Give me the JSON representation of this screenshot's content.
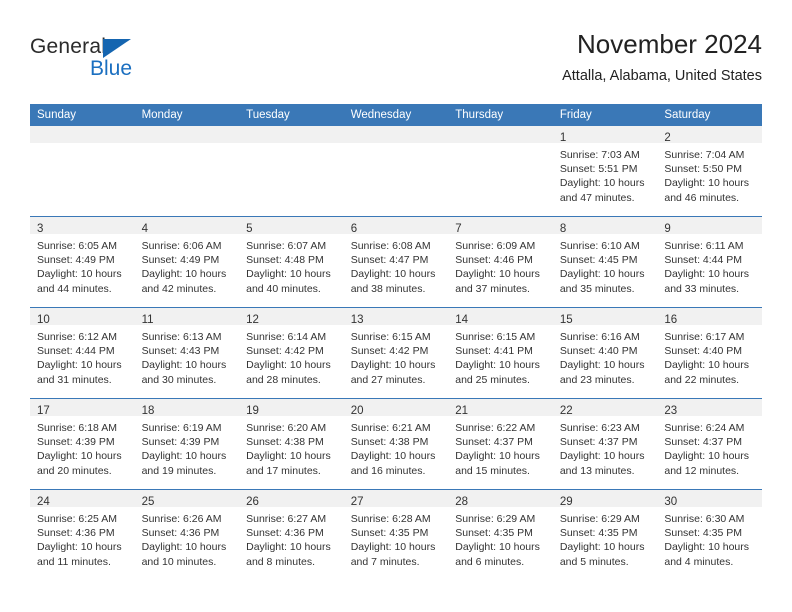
{
  "brand": {
    "name_top": "General",
    "name_bottom": "Blue",
    "triangle_color": "#1565b0",
    "blue_color": "#1b6fc0"
  },
  "header": {
    "title": "November 2024",
    "subtitle": "Attalla, Alabama, United States"
  },
  "theme": {
    "header_blue": "#3a78b7",
    "daynum_band": "#f1f1f1",
    "text": "#333333"
  },
  "columns": [
    "Sunday",
    "Monday",
    "Tuesday",
    "Wednesday",
    "Thursday",
    "Friday",
    "Saturday"
  ],
  "weeks": [
    [
      {
        "day": "",
        "sunrise": "",
        "sunset": "",
        "daylight": ""
      },
      {
        "day": "",
        "sunrise": "",
        "sunset": "",
        "daylight": ""
      },
      {
        "day": "",
        "sunrise": "",
        "sunset": "",
        "daylight": ""
      },
      {
        "day": "",
        "sunrise": "",
        "sunset": "",
        "daylight": ""
      },
      {
        "day": "",
        "sunrise": "",
        "sunset": "",
        "daylight": ""
      },
      {
        "day": "1",
        "sunrise": "Sunrise: 7:03 AM",
        "sunset": "Sunset: 5:51 PM",
        "daylight": "Daylight: 10 hours and 47 minutes."
      },
      {
        "day": "2",
        "sunrise": "Sunrise: 7:04 AM",
        "sunset": "Sunset: 5:50 PM",
        "daylight": "Daylight: 10 hours and 46 minutes."
      }
    ],
    [
      {
        "day": "3",
        "sunrise": "Sunrise: 6:05 AM",
        "sunset": "Sunset: 4:49 PM",
        "daylight": "Daylight: 10 hours and 44 minutes."
      },
      {
        "day": "4",
        "sunrise": "Sunrise: 6:06 AM",
        "sunset": "Sunset: 4:49 PM",
        "daylight": "Daylight: 10 hours and 42 minutes."
      },
      {
        "day": "5",
        "sunrise": "Sunrise: 6:07 AM",
        "sunset": "Sunset: 4:48 PM",
        "daylight": "Daylight: 10 hours and 40 minutes."
      },
      {
        "day": "6",
        "sunrise": "Sunrise: 6:08 AM",
        "sunset": "Sunset: 4:47 PM",
        "daylight": "Daylight: 10 hours and 38 minutes."
      },
      {
        "day": "7",
        "sunrise": "Sunrise: 6:09 AM",
        "sunset": "Sunset: 4:46 PM",
        "daylight": "Daylight: 10 hours and 37 minutes."
      },
      {
        "day": "8",
        "sunrise": "Sunrise: 6:10 AM",
        "sunset": "Sunset: 4:45 PM",
        "daylight": "Daylight: 10 hours and 35 minutes."
      },
      {
        "day": "9",
        "sunrise": "Sunrise: 6:11 AM",
        "sunset": "Sunset: 4:44 PM",
        "daylight": "Daylight: 10 hours and 33 minutes."
      }
    ],
    [
      {
        "day": "10",
        "sunrise": "Sunrise: 6:12 AM",
        "sunset": "Sunset: 4:44 PM",
        "daylight": "Daylight: 10 hours and 31 minutes."
      },
      {
        "day": "11",
        "sunrise": "Sunrise: 6:13 AM",
        "sunset": "Sunset: 4:43 PM",
        "daylight": "Daylight: 10 hours and 30 minutes."
      },
      {
        "day": "12",
        "sunrise": "Sunrise: 6:14 AM",
        "sunset": "Sunset: 4:42 PM",
        "daylight": "Daylight: 10 hours and 28 minutes."
      },
      {
        "day": "13",
        "sunrise": "Sunrise: 6:15 AM",
        "sunset": "Sunset: 4:42 PM",
        "daylight": "Daylight: 10 hours and 27 minutes."
      },
      {
        "day": "14",
        "sunrise": "Sunrise: 6:15 AM",
        "sunset": "Sunset: 4:41 PM",
        "daylight": "Daylight: 10 hours and 25 minutes."
      },
      {
        "day": "15",
        "sunrise": "Sunrise: 6:16 AM",
        "sunset": "Sunset: 4:40 PM",
        "daylight": "Daylight: 10 hours and 23 minutes."
      },
      {
        "day": "16",
        "sunrise": "Sunrise: 6:17 AM",
        "sunset": "Sunset: 4:40 PM",
        "daylight": "Daylight: 10 hours and 22 minutes."
      }
    ],
    [
      {
        "day": "17",
        "sunrise": "Sunrise: 6:18 AM",
        "sunset": "Sunset: 4:39 PM",
        "daylight": "Daylight: 10 hours and 20 minutes."
      },
      {
        "day": "18",
        "sunrise": "Sunrise: 6:19 AM",
        "sunset": "Sunset: 4:39 PM",
        "daylight": "Daylight: 10 hours and 19 minutes."
      },
      {
        "day": "19",
        "sunrise": "Sunrise: 6:20 AM",
        "sunset": "Sunset: 4:38 PM",
        "daylight": "Daylight: 10 hours and 17 minutes."
      },
      {
        "day": "20",
        "sunrise": "Sunrise: 6:21 AM",
        "sunset": "Sunset: 4:38 PM",
        "daylight": "Daylight: 10 hours and 16 minutes."
      },
      {
        "day": "21",
        "sunrise": "Sunrise: 6:22 AM",
        "sunset": "Sunset: 4:37 PM",
        "daylight": "Daylight: 10 hours and 15 minutes."
      },
      {
        "day": "22",
        "sunrise": "Sunrise: 6:23 AM",
        "sunset": "Sunset: 4:37 PM",
        "daylight": "Daylight: 10 hours and 13 minutes."
      },
      {
        "day": "23",
        "sunrise": "Sunrise: 6:24 AM",
        "sunset": "Sunset: 4:37 PM",
        "daylight": "Daylight: 10 hours and 12 minutes."
      }
    ],
    [
      {
        "day": "24",
        "sunrise": "Sunrise: 6:25 AM",
        "sunset": "Sunset: 4:36 PM",
        "daylight": "Daylight: 10 hours and 11 minutes."
      },
      {
        "day": "25",
        "sunrise": "Sunrise: 6:26 AM",
        "sunset": "Sunset: 4:36 PM",
        "daylight": "Daylight: 10 hours and 10 minutes."
      },
      {
        "day": "26",
        "sunrise": "Sunrise: 6:27 AM",
        "sunset": "Sunset: 4:36 PM",
        "daylight": "Daylight: 10 hours and 8 minutes."
      },
      {
        "day": "27",
        "sunrise": "Sunrise: 6:28 AM",
        "sunset": "Sunset: 4:35 PM",
        "daylight": "Daylight: 10 hours and 7 minutes."
      },
      {
        "day": "28",
        "sunrise": "Sunrise: 6:29 AM",
        "sunset": "Sunset: 4:35 PM",
        "daylight": "Daylight: 10 hours and 6 minutes."
      },
      {
        "day": "29",
        "sunrise": "Sunrise: 6:29 AM",
        "sunset": "Sunset: 4:35 PM",
        "daylight": "Daylight: 10 hours and 5 minutes."
      },
      {
        "day": "30",
        "sunrise": "Sunrise: 6:30 AM",
        "sunset": "Sunset: 4:35 PM",
        "daylight": "Daylight: 10 hours and 4 minutes."
      }
    ]
  ]
}
